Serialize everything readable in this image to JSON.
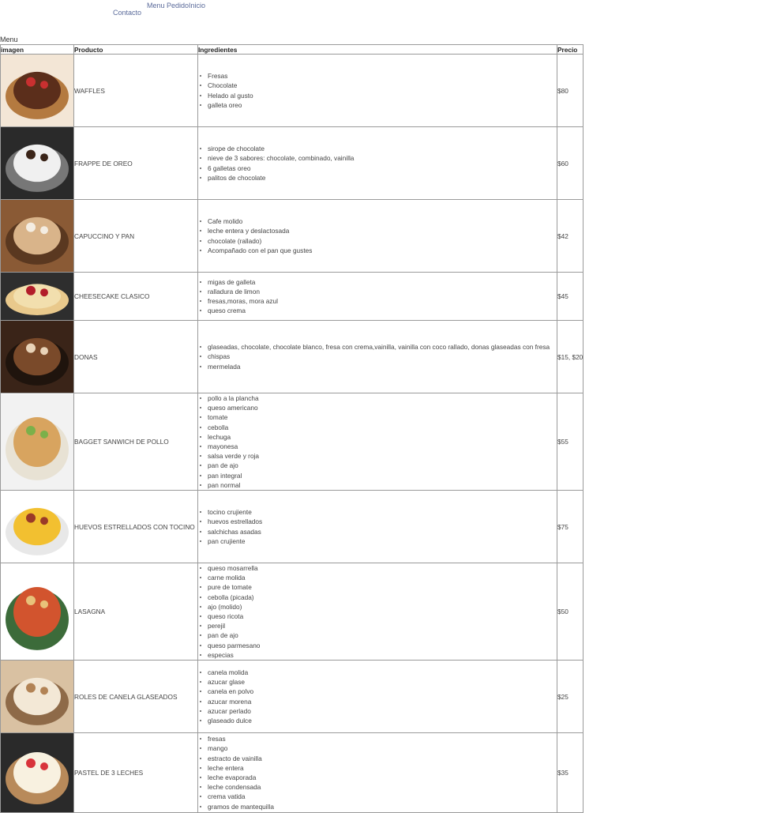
{
  "nav": {
    "contact": "Contacto",
    "menu": "Menu PedidoInicio"
  },
  "table": {
    "caption": "Menu",
    "headers": [
      "imagen",
      "Producto",
      "Ingredientes",
      "Precio"
    ],
    "rows": [
      {
        "producto": "WAFFLES",
        "precio": "$80",
        "ingredientes": [
          "Fresas",
          "Chocolate",
          "Helado al gusto",
          "galleta oreo"
        ]
      },
      {
        "producto": "FRAPPE DE OREO",
        "precio": "$60",
        "ingredientes": [
          "sirope de chocolate",
          "nieve de 3 sabores: chocolate, combinado, vainilla",
          "6 galletas oreo",
          "palitos de chocolate"
        ]
      },
      {
        "producto": "CAPUCCINO Y PAN",
        "precio": "$42",
        "ingredientes": [
          "Cafe molido",
          "leche entera y deslactosada",
          "chocolate (rallado)",
          "Acompañado con el pan que gustes"
        ]
      },
      {
        "producto": "CHEESECAKE CLASICO",
        "precio": "$45",
        "ingredientes": [
          "migas de galleta",
          "ralladura de limon",
          "fresas,moras, mora azul",
          "queso crema"
        ]
      },
      {
        "producto": "DONAS",
        "precio": "$15, $20",
        "ingredientes": [
          "glaseadas, chocolate, chocolate blanco, fresa con crema,vainilla, vainilla con coco rallado, donas glaseadas con fresa",
          "chispas",
          "mermelada"
        ]
      },
      {
        "producto": "BAGGET SANWICH DE POLLO",
        "precio": "$55",
        "ingredientes": [
          "pollo a la plancha",
          "queso americano",
          "tomate",
          "cebolla",
          "lechuga",
          "mayonesa",
          "salsa verde y roja",
          "pan de ajo",
          "pan integral",
          "pan normal"
        ]
      },
      {
        "producto": "HUEVOS ESTRELLADOS CON TOCINO",
        "precio": "$75",
        "ingredientes": [
          "tocino crujiente",
          "huevos estrellados",
          "salchichas asadas",
          "pan crujiente"
        ]
      },
      {
        "producto": "LASAGNA",
        "precio": "$50",
        "ingredientes": [
          "queso mosarrella",
          "carne molida",
          "pure de tomate",
          "cebolla (picada)",
          "ajo (molido)",
          "queso ricota",
          "perejil",
          "pan de ajo",
          "queso parmesano",
          "especias"
        ]
      },
      {
        "producto": "ROLES DE CANELA GLASEADOS",
        "precio": "$25",
        "ingredientes": [
          "canela molida",
          "azucar glase",
          "canela en polvo",
          "azucar morena",
          "azucar perlado",
          "glaseado dulce"
        ]
      },
      {
        "producto": "PASTEL DE 3 LECHES",
        "precio": "$35",
        "ingredientes": [
          "fresas",
          "mango",
          "estracto de vainilla",
          "leche entera",
          "leche evaporada",
          "leche condensada",
          "crema vatida",
          "gramos de mantequilla"
        ]
      }
    ]
  }
}
